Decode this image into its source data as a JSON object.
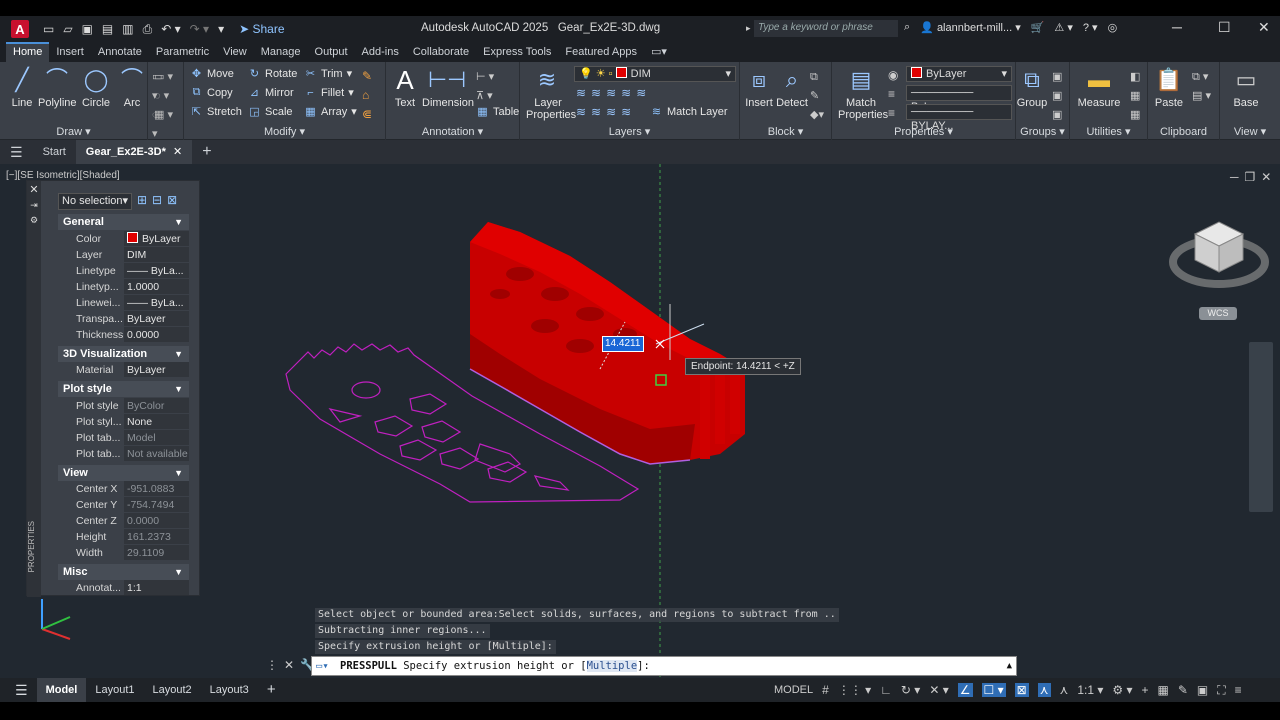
{
  "app": {
    "title": "Autodesk AutoCAD 2025",
    "file": "Gear_Ex2E-3D.dwg",
    "share_label": "Share",
    "search_placeholder": "Type a keyword or phrase",
    "user": "alannbert-mill..."
  },
  "ribbon_tabs": [
    "Home",
    "Insert",
    "Annotate",
    "Parametric",
    "View",
    "Manage",
    "Output",
    "Add-ins",
    "Collaborate",
    "Express Tools",
    "Featured Apps"
  ],
  "ribbon": {
    "draw": {
      "title": "Draw",
      "line": "Line",
      "polyline": "Polyline",
      "circle": "Circle",
      "arc": "Arc"
    },
    "modify": {
      "title": "Modify",
      "move": "Move",
      "rotate": "Rotate",
      "trim": "Trim",
      "copy": "Copy",
      "mirror": "Mirror",
      "fillet": "Fillet",
      "stretch": "Stretch",
      "scale": "Scale",
      "array": "Array"
    },
    "annotation": {
      "title": "Annotation",
      "text": "Text",
      "dimension": "Dimension",
      "table": "Table"
    },
    "layers": {
      "title": "Layers",
      "layer_properties": "Layer Properties",
      "current_layer": "DIM",
      "match_layer": "Match Layer"
    },
    "block": {
      "title": "Block",
      "insert": "Insert",
      "detect": "Detect"
    },
    "properties": {
      "title": "Properties",
      "match_properties": "Match Properties",
      "color": "ByLayer",
      "linetype": "ByLayer",
      "lineweight": "BYLAY..."
    },
    "groups": {
      "title": "Groups",
      "group": "Group"
    },
    "utilities": {
      "title": "Utilities",
      "measure": "Measure"
    },
    "clipboard": {
      "title": "Clipboard",
      "paste": "Paste"
    },
    "view": {
      "title": "View",
      "base": "Base"
    }
  },
  "doc_tabs": {
    "start": "Start",
    "active": "Gear_Ex2E-3D*"
  },
  "viewport": {
    "label": "[−][SE Isometric][Shaded]",
    "wcs": "WCS",
    "dim_value": "14.4211",
    "tooltip": "Endpoint: 14.4211 < +Z"
  },
  "properties_palette": {
    "selection": "No selection",
    "side_label": "PROPERTIES",
    "sections": {
      "general": "General",
      "visualization": "3D Visualization",
      "plot_style": "Plot style",
      "view": "View",
      "misc": "Misc"
    },
    "general": [
      {
        "key": "Color",
        "value": "ByLayer"
      },
      {
        "key": "Layer",
        "value": "DIM"
      },
      {
        "key": "Linetype",
        "value": "—— ByLa..."
      },
      {
        "key": "Linetyp...",
        "value": "1.0000"
      },
      {
        "key": "Linewei...",
        "value": "—— ByLa..."
      },
      {
        "key": "Transpa...",
        "value": "ByLayer"
      },
      {
        "key": "Thickness",
        "value": "0.0000"
      }
    ],
    "visualization": [
      {
        "key": "Material",
        "value": "ByLayer"
      }
    ],
    "plot_style": [
      {
        "key": "Plot style",
        "value": "ByColor"
      },
      {
        "key": "Plot styl...",
        "value": "None"
      },
      {
        "key": "Plot tab...",
        "value": "Model"
      },
      {
        "key": "Plot tab...",
        "value": "Not available"
      }
    ],
    "view": [
      {
        "key": "Center X",
        "value": "-951.0883"
      },
      {
        "key": "Center Y",
        "value": "-754.7494"
      },
      {
        "key": "Center Z",
        "value": "0.0000"
      },
      {
        "key": "Height",
        "value": "161.2373"
      },
      {
        "key": "Width",
        "value": "29.1109"
      }
    ],
    "misc": [
      {
        "key": "Annotat...",
        "value": "1:1"
      }
    ]
  },
  "command": {
    "history": [
      "Select object or bounded area:Select solids, surfaces, and regions to subtract from ..",
      "Subtracting inner regions...",
      "Specify extrusion height or [Multiple]:"
    ],
    "prompt_cmd": "PRESSPULL",
    "prompt_text": "Specify extrusion height or [",
    "prompt_option": "Multiple",
    "prompt_end": "]:"
  },
  "layout_tabs": [
    "Model",
    "Layout1",
    "Layout2",
    "Layout3"
  ],
  "status": {
    "model": "MODEL",
    "scale": "1:1"
  },
  "colors": {
    "solid": "#e00000",
    "profile": "#c020c0",
    "viewport_bg": "#212830"
  }
}
